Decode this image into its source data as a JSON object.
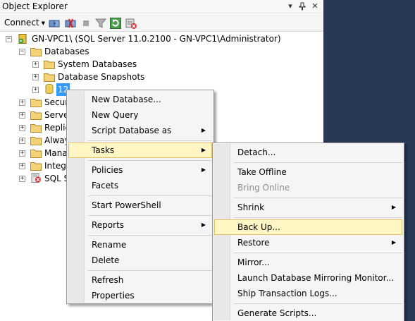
{
  "panel": {
    "title": "Object Explorer",
    "pin_glyph": "▾",
    "pushpin_glyph": "ꟷ",
    "close_glyph": "✕"
  },
  "toolbar": {
    "connect_label": "Connect",
    "connect_arrow": "▼"
  },
  "tree": {
    "server": "GN-VPC1\\ (SQL Server 11.0.2100 - GN-VPC1\\Administrator)",
    "databases": "Databases",
    "system_databases": "System Databases",
    "database_snapshots": "Database Snapshots",
    "selected_db": "12",
    "security": "Securi",
    "server_objects": "Server",
    "replication": "Replic",
    "always_on": "Alway",
    "management": "Mana",
    "integration": "Integr",
    "sql_agent": "SQL S"
  },
  "context_menu": {
    "new_database": "New Database...",
    "new_query": "New Query",
    "script_database_as": "Script Database as",
    "tasks": "Tasks",
    "policies": "Policies",
    "facets": "Facets",
    "start_powershell": "Start PowerShell",
    "reports": "Reports",
    "rename": "Rename",
    "delete": "Delete",
    "refresh": "Refresh",
    "properties": "Properties"
  },
  "tasks_menu": {
    "detach": "Detach...",
    "take_offline": "Take Offline",
    "bring_online": "Bring Online",
    "shrink": "Shrink",
    "back_up": "Back Up...",
    "restore": "Restore",
    "mirror": "Mirror...",
    "launch_mirroring_monitor": "Launch Database Mirroring Monitor...",
    "ship_transaction_logs": "Ship Transaction Logs...",
    "generate_scripts": "Generate Scripts..."
  },
  "submenu_arrow": "▶"
}
